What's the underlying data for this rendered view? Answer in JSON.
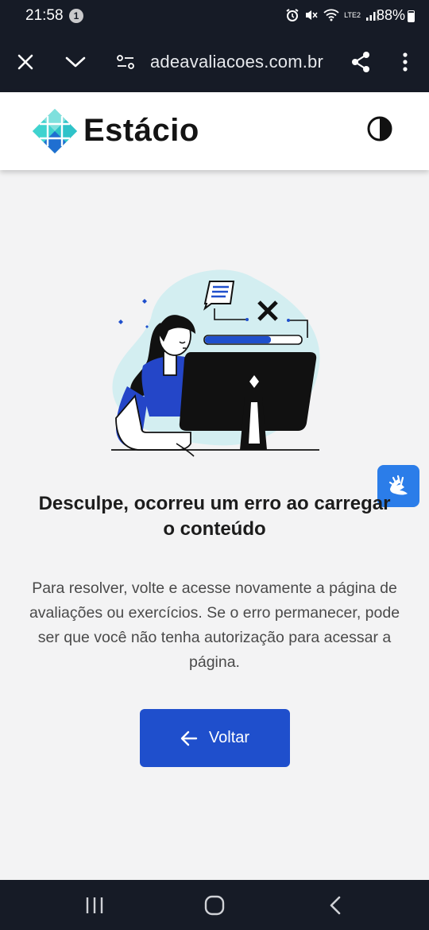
{
  "status_bar": {
    "time": "21:58",
    "notification_count": "1",
    "network_label": "LTE2",
    "battery": "88%"
  },
  "browser": {
    "url": "adeavaliacoes.com.br",
    "icons": [
      "close-icon",
      "chevron-down-icon",
      "site-settings-icon",
      "share-icon",
      "more-vert-icon"
    ]
  },
  "header": {
    "logo_text": "Estácio",
    "brand_colors": {
      "teal": "#2fc3c9",
      "blue": "#1f6fd1",
      "green": "#27b6a8"
    }
  },
  "error": {
    "title": "Desculpe, ocorreu um erro ao carregar o conteúdo",
    "description": "Para resolver, volte e acesse novamente a página de avaliações ou exercícios. Se o erro permanecer, pode ser que você não tenha autorização para acessar a página.",
    "back_button_label": "Voltar"
  },
  "colors": {
    "primary_button": "#1f4fcc",
    "libras_button": "#2b7de9",
    "page_background": "#f3f3f4",
    "system_bars": "#161b26"
  }
}
